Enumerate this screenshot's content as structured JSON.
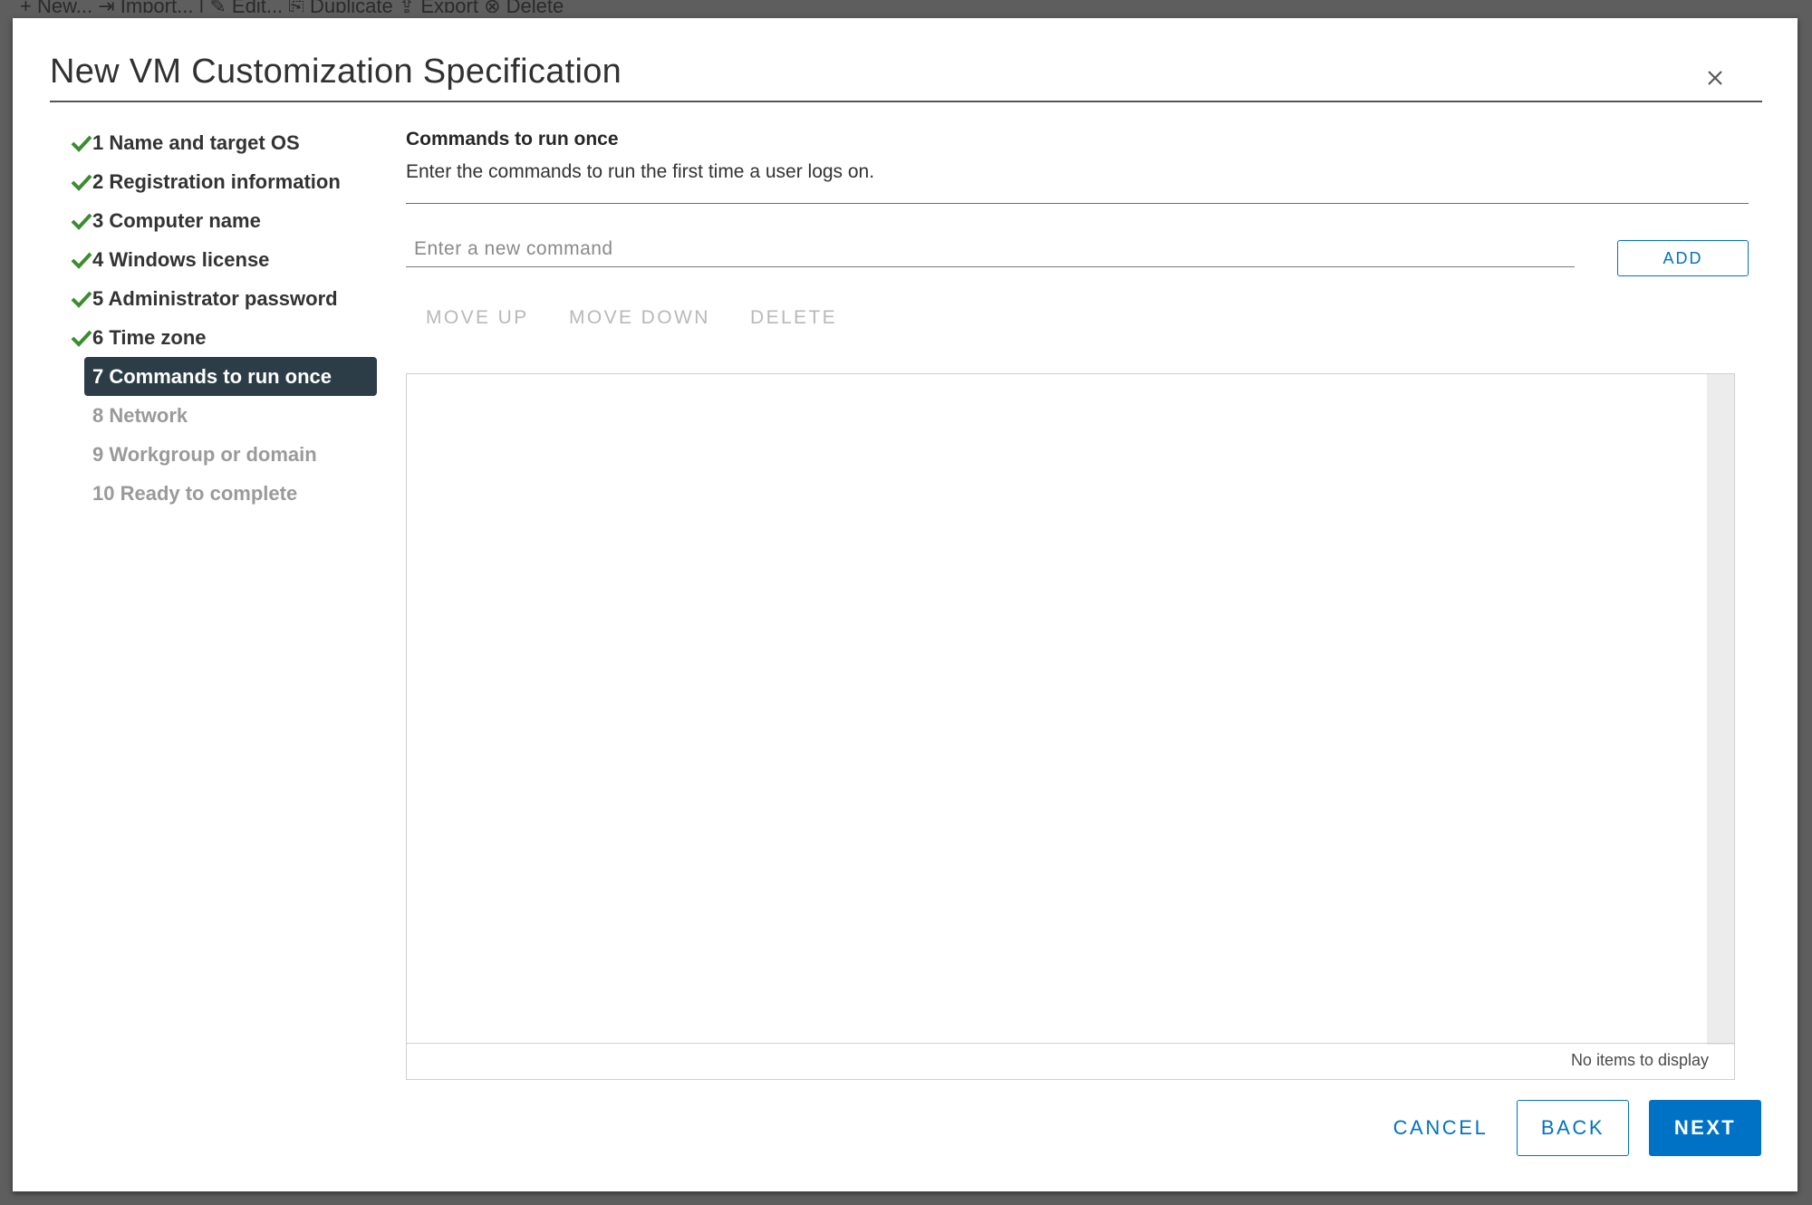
{
  "background": {
    "toolbar_text": "+ New...    ⇥ Import...    |  ✎ Edit...    ⎘ Duplicate    ⇪ Export    ⊗ Delete"
  },
  "modal": {
    "title": "New VM Customization Specification",
    "close_icon": "close-icon"
  },
  "steps": [
    {
      "label": "1 Name and target OS",
      "state": "complete"
    },
    {
      "label": "2 Registration information",
      "state": "complete"
    },
    {
      "label": "3 Computer name",
      "state": "complete"
    },
    {
      "label": "4 Windows license",
      "state": "complete"
    },
    {
      "label": "5 Administrator password",
      "state": "complete"
    },
    {
      "label": "6 Time zone",
      "state": "complete"
    },
    {
      "label": "7 Commands to run once",
      "state": "active"
    },
    {
      "label": "8 Network",
      "state": "disabled"
    },
    {
      "label": "9 Workgroup or domain",
      "state": "disabled"
    },
    {
      "label": "10 Ready to complete",
      "state": "disabled"
    }
  ],
  "content": {
    "title": "Commands to run once",
    "description": "Enter the commands to run the first time a user logs on.",
    "command_input": {
      "value": "",
      "placeholder": "Enter a new command"
    },
    "add_label": "ADD",
    "actions": {
      "move_up": "MOVE UP",
      "move_down": "MOVE DOWN",
      "delete": "DELETE"
    },
    "grid": {
      "footer_text": "No items to display"
    }
  },
  "footer": {
    "cancel": "CANCEL",
    "back": "BACK",
    "next": "NEXT"
  },
  "colors": {
    "accent": "#0072c6",
    "active_step": "#2d3d48",
    "check": "#3c8d2f",
    "disabled_text": "#9a9a9a"
  }
}
